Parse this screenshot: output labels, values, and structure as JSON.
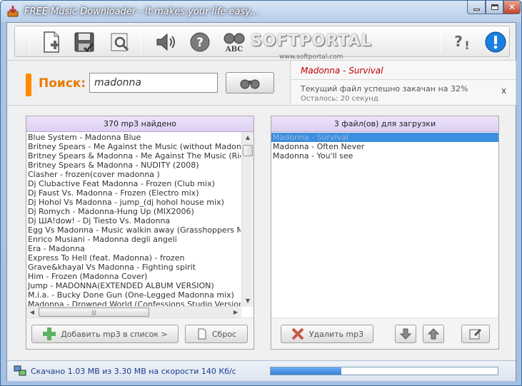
{
  "window": {
    "title": "FREE Music Downloader - It makes your life easy...",
    "controls": [
      "minimize",
      "maximize",
      "close"
    ]
  },
  "toolbar": {
    "buttons": [
      {
        "name": "new-list",
        "icon": "new-document-icon"
      },
      {
        "name": "save-list",
        "icon": "save-disk-icon"
      },
      {
        "name": "open-list",
        "icon": "open-folder-search-icon"
      },
      {
        "name": "sound",
        "icon": "speaker-icon"
      },
      {
        "name": "help",
        "icon": "question-circle-icon"
      },
      {
        "name": "abc",
        "icon": "binoculars-abc-icon"
      },
      {
        "name": "about",
        "icon": "question-exclamation-icon"
      },
      {
        "name": "info",
        "icon": "info-exclamation-icon"
      }
    ],
    "watermark": "SOFTPORTAL",
    "watermark_sub": "www.softportal.com"
  },
  "search": {
    "label": "Поиск:",
    "value": "madonna",
    "button_icon": "binoculars-icon"
  },
  "now_playing": {
    "title": "Madonna - Survival",
    "progress_text": "Текущий файл успешно закачан на 32%",
    "remaining_text": "Осталось: 20 секунд",
    "close_label": "x"
  },
  "results": {
    "header": "370 mp3 найдено",
    "items": [
      "Blue System - Madonna Blue",
      "Britney Spears - Me Against the Music (without Madonna)",
      "Britney Spears & Madonna - Me Against The Music (Richi Rich Remix)",
      "Britney Spears & Madonna - NUDITY (2008)",
      "Clasher - frozen(cover madonna )",
      "Dj Clubactive Feat Madonna - Frozen (Club mix)",
      "Dj Faust Vs. Madonna - Frozen (Electro mix)",
      "Dj Hohol Vs Madonna - jump_(dj hohol house mix)",
      "Dj Romych - Madonna-Hung Up (MIX2006)",
      "Dj ША!dow! - Dj Tiesto Vs. Madonna",
      "Egg Vs Madonna - Music walkin away (Grasshoppers Mix)",
      "Enrico Musiani - Madonna degli angeli",
      "Era - Madonna",
      "Express To Hell (feat. Madonna) - frozen",
      "Grave&khayal Vs Madonna - Fighting spirit",
      "Him - Frozen (Madonna Cover)",
      "Jump - MADONNA(EXTENDED ALBUM VERSION)",
      "M.i.a. - Bucky Done Gun (One-Legged Madonna mix)",
      "Madonna - Drowned World (Confessions Studio Version)"
    ],
    "add_button": "Добавить mp3 в список >",
    "reset_button": "Сброс"
  },
  "queue": {
    "header": "3 файл(ов) для загрузки",
    "items": [
      "Madonna - Survival",
      "Madonna - Often Never",
      "Madonna - You'll see"
    ],
    "selected_index": 0,
    "delete_button": "Удалить mp3"
  },
  "statusbar": {
    "text": "Скачано 1.03 MB из 3.30 MB на скорости 140 Кб/с",
    "progress": 0.31
  },
  "colors": {
    "accent": "#ff8a00",
    "title_red": "#c00000",
    "selection": "#3c8ede",
    "header_lilac": "#ddd0f2"
  }
}
